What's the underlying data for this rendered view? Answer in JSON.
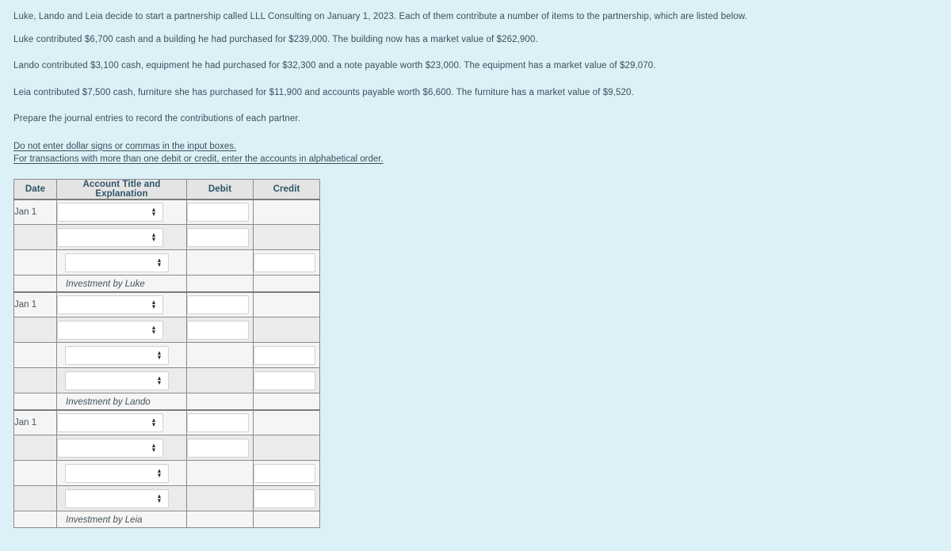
{
  "colors": {
    "page_background": "#dcf0f8",
    "text": "#3c4f5a",
    "header_background": "#e4e4e4",
    "header_text": "#2f5468",
    "table_border": "#8a8a8a",
    "row_light": "#f5f5f5",
    "row_dark": "#ebebeb",
    "input_background": "#ffffff",
    "input_border": "#c9d4da"
  },
  "problem": {
    "paragraphs": [
      "Luke, Lando and Leia decide to start a partnership called LLL Consulting on January 1, 2023. Each of them contribute a number of items to the partnership, which are listed below.",
      "Luke contributed $6,700 cash and a building he had purchased for $239,000. The building now has a market value of $262,900.",
      "Lando contributed $3,100 cash, equipment he had purchased for $32,300 and a note payable worth $23,000. The equipment has a market value of $29,070.",
      "Leia contributed $7,500 cash, furniture she has purchased for $11,900 and accounts payable worth $6,600. The furniture has a market value of $9,520.",
      "Prepare the journal entries to record the contributions of each partner."
    ],
    "instructions": [
      "Do not enter dollar signs or commas in the input boxes.",
      "For transactions with more than one debit or credit, enter the accounts in alphabetical order."
    ]
  },
  "journal": {
    "columns": {
      "date": "Date",
      "account": "Account Title and Explanation",
      "debit": "Debit",
      "credit": "Credit"
    },
    "spinner_icon": "spinner-updown-icon",
    "rows": [
      {
        "type": "debit",
        "date": "Jan 1",
        "account_value": "",
        "debit_value": "",
        "credit_value": "",
        "shade": "a",
        "section_start": true
      },
      {
        "type": "debit",
        "date": "",
        "account_value": "",
        "debit_value": "",
        "credit_value": "",
        "shade": "b",
        "section_start": false
      },
      {
        "type": "credit",
        "date": "",
        "account_value": "",
        "debit_value": "",
        "credit_value": "",
        "shade": "a",
        "section_start": false
      },
      {
        "type": "explanation",
        "date": "",
        "explanation": "Investment by Luke",
        "shade": "a",
        "section_start": false
      },
      {
        "type": "debit",
        "date": "Jan 1",
        "account_value": "",
        "debit_value": "",
        "credit_value": "",
        "shade": "a",
        "section_start": true
      },
      {
        "type": "debit",
        "date": "",
        "account_value": "",
        "debit_value": "",
        "credit_value": "",
        "shade": "b",
        "section_start": false
      },
      {
        "type": "credit",
        "date": "",
        "account_value": "",
        "debit_value": "",
        "credit_value": "",
        "shade": "a",
        "section_start": false
      },
      {
        "type": "credit",
        "date": "",
        "account_value": "",
        "debit_value": "",
        "credit_value": "",
        "shade": "b",
        "section_start": false
      },
      {
        "type": "explanation",
        "date": "",
        "explanation": "Investment by Lando",
        "shade": "a",
        "section_start": false
      },
      {
        "type": "debit",
        "date": "Jan 1",
        "account_value": "",
        "debit_value": "",
        "credit_value": "",
        "shade": "a",
        "section_start": true
      },
      {
        "type": "debit",
        "date": "",
        "account_value": "",
        "debit_value": "",
        "credit_value": "",
        "shade": "b",
        "section_start": false
      },
      {
        "type": "credit",
        "date": "",
        "account_value": "",
        "debit_value": "",
        "credit_value": "",
        "shade": "a",
        "section_start": false
      },
      {
        "type": "credit",
        "date": "",
        "account_value": "",
        "debit_value": "",
        "credit_value": "",
        "shade": "b",
        "section_start": false
      },
      {
        "type": "explanation",
        "date": "",
        "explanation": "Investment by Leia",
        "shade": "a",
        "section_start": false
      }
    ]
  }
}
